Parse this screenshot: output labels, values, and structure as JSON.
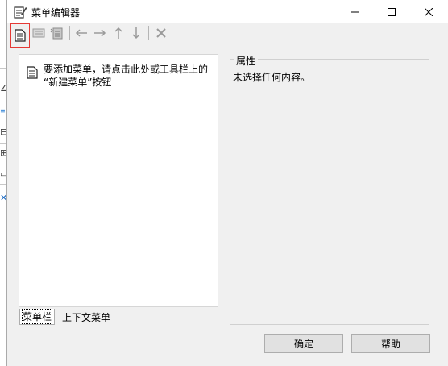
{
  "window": {
    "title": "菜单编辑器"
  },
  "toolbar": {
    "items": [
      {
        "name": "new-menu",
        "enabled": true,
        "highlighted": true
      },
      {
        "name": "new-menu-item",
        "enabled": false
      },
      {
        "name": "new-submenu",
        "enabled": false
      },
      {
        "name": "move-left",
        "enabled": false
      },
      {
        "name": "move-right",
        "enabled": false
      },
      {
        "name": "move-up",
        "enabled": false
      },
      {
        "name": "move-down",
        "enabled": false
      },
      {
        "name": "delete",
        "enabled": false
      }
    ]
  },
  "menu_list": {
    "hint_line1": "要添加菜单，请点击此处或工具栏上的",
    "hint_line2": "“新建菜单”按钮"
  },
  "properties": {
    "title": "属性",
    "empty_text": "未选择任何内容。"
  },
  "tabs": [
    {
      "label": "菜单栏",
      "active": true
    },
    {
      "label": "上下文菜单",
      "active": false
    }
  ],
  "buttons": {
    "ok": "确定",
    "help": "帮助"
  },
  "colors": {
    "highlight_border": "#e53935",
    "disabled_icon": "#9a9a9a"
  }
}
